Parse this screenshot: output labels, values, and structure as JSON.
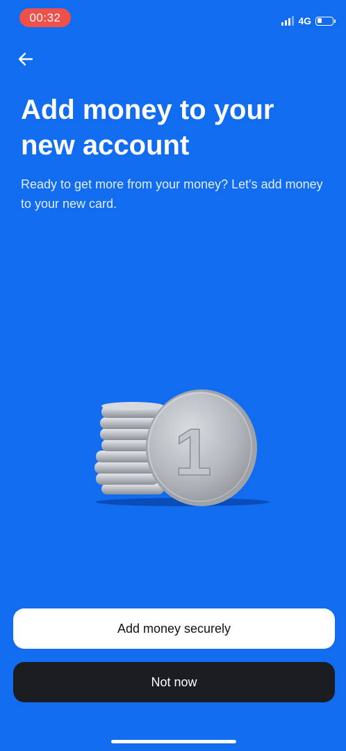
{
  "status_bar": {
    "time": "00:32",
    "network": "4G",
    "battery_level": 0.3
  },
  "icons": {
    "back": "back-arrow-icon",
    "signal": "cellular-signal-icon",
    "battery": "battery-icon"
  },
  "header": {
    "title": "Add money to your new account",
    "subtitle": "Ready to get more from your money? Let's add money to your new card."
  },
  "illustration": {
    "coin_label": "1"
  },
  "actions": {
    "primary_label": "Add money securely",
    "secondary_label": "Not now"
  },
  "colors": {
    "background": "#126cf0",
    "primary_button": "#ffffff",
    "secondary_button": "#1c1d22",
    "time_pill": "#f0504a"
  }
}
